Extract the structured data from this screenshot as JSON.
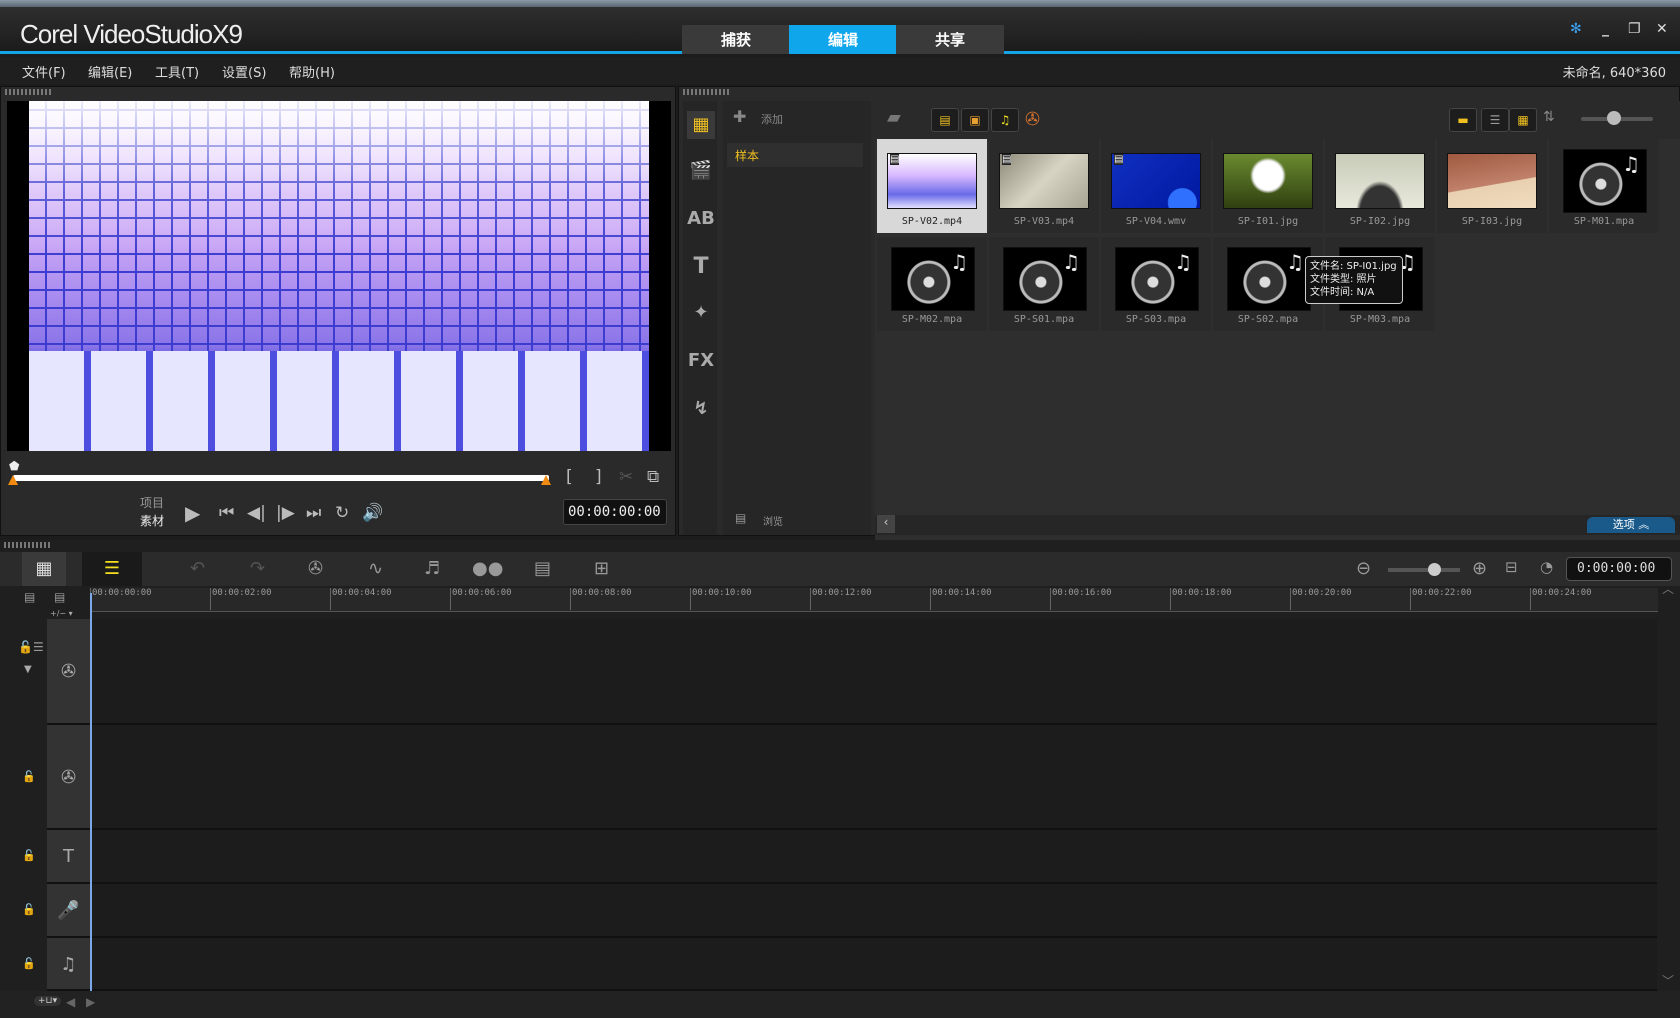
{
  "app": {
    "title": "Corel VideoStudio X9",
    "logo_text": "Corel VideoStudioX9"
  },
  "main_tabs": [
    {
      "label": "捕获"
    },
    {
      "label": "编辑",
      "active": true
    },
    {
      "label": "共享"
    }
  ],
  "window_controls": [
    "help-icon",
    "minimize-icon",
    "restore-icon",
    "close-icon"
  ],
  "menu": [
    {
      "label": "文件(F)"
    },
    {
      "label": "编辑(E)"
    },
    {
      "label": "工具(T)"
    },
    {
      "label": "设置(S)"
    },
    {
      "label": "帮助(H)"
    }
  ],
  "project_info": "未命名, 640*360",
  "player": {
    "mode_project": "项目",
    "mode_clip": "素材",
    "timecode": "00:00:00:00",
    "mark_in": "[",
    "mark_out": "]",
    "progress": 0
  },
  "library": {
    "add_label": "添加",
    "browse_label": "浏览",
    "options_label": "选项",
    "folders": [
      {
        "label": "样本",
        "selected": true
      }
    ],
    "accent": "#f0c020",
    "items": [
      {
        "name": "SP-V02.mp4",
        "type": "video",
        "selected": true
      },
      {
        "name": "SP-V03.mp4",
        "type": "video"
      },
      {
        "name": "SP-V04.wmv",
        "type": "video"
      },
      {
        "name": "SP-I01.jpg",
        "type": "image"
      },
      {
        "name": "SP-I02.jpg",
        "type": "image"
      },
      {
        "name": "SP-I03.jpg",
        "type": "image"
      },
      {
        "name": "SP-M01.mpa",
        "type": "audio"
      },
      {
        "name": "SP-M02.mpa",
        "type": "audio"
      },
      {
        "name": "SP-S01.mpa",
        "type": "audio"
      },
      {
        "name": "SP-S03.mpa",
        "type": "audio"
      },
      {
        "name": "SP-S02.mpa",
        "type": "audio"
      },
      {
        "name": "SP-M03.mpa",
        "type": "audio"
      }
    ],
    "tooltip": {
      "line1": "文件名: SP-I01.jpg",
      "line2": "文件类型: 照片",
      "line3": "文件时间: N/A"
    }
  },
  "timeline": {
    "timecode": "0:00:00:00",
    "add_remove_label": "+/− ▾",
    "ticks": [
      "00:00:00:00",
      "00:00:02:00",
      "00:00:04:00",
      "00:00:06:00",
      "00:00:08:00",
      "00:00:10:00",
      "00:00:12:00",
      "00:00:14:00",
      "00:00:16:00",
      "00:00:18:00",
      "00:00:20:00",
      "00:00:22:00",
      "00:00:24:00"
    ],
    "tracks": [
      {
        "icon": "video-track-icon"
      },
      {
        "icon": "overlay-track-icon"
      },
      {
        "icon": "title-track-icon"
      },
      {
        "icon": "voice-track-icon"
      },
      {
        "icon": "music-track-icon"
      }
    ]
  }
}
